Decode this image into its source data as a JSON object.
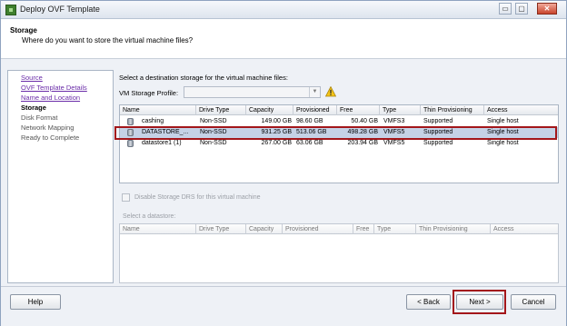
{
  "window": {
    "title": "Deploy OVF Template",
    "min_glyph": "▭",
    "max_glyph": "▢",
    "close_glyph": "✕"
  },
  "header": {
    "title": "Storage",
    "subtitle": "Where do you want to store the virtual machine files?"
  },
  "nav": {
    "items": [
      {
        "label": "Source",
        "state": "link"
      },
      {
        "label": "OVF Template Details",
        "state": "link"
      },
      {
        "label": "Name and Location",
        "state": "link"
      },
      {
        "label": "Storage",
        "state": "current"
      },
      {
        "label": "Disk Format",
        "state": "pending"
      },
      {
        "label": "Network Mapping",
        "state": "pending"
      },
      {
        "label": "Ready to Complete",
        "state": "pending"
      }
    ]
  },
  "main": {
    "instruction": "Select a destination storage for the virtual machine files:",
    "profile_label": "VM Storage Profile:",
    "profile_value": "",
    "warning_icon": "warning-icon"
  },
  "storage_table": {
    "columns": [
      "Name",
      "Drive Type",
      "Capacity",
      "Provisioned",
      "Free",
      "Type",
      "Thin Provisioning",
      "Access"
    ],
    "rows": [
      {
        "name": "cashing",
        "drive_type": "Non-SSD",
        "capacity": "149.00 GB",
        "provisioned": "98.60 GB",
        "free": "50.40 GB",
        "type": "VMFS3",
        "thin": "Supported",
        "access": "Single host"
      },
      {
        "name": "DATASTORE_...",
        "drive_type": "Non-SSD",
        "capacity": "931.25 GB",
        "provisioned": "513.06 GB",
        "free": "498.28 GB",
        "type": "VMFS5",
        "thin": "Supported",
        "access": "Single host"
      },
      {
        "name": "datastore1 (1)",
        "drive_type": "Non-SSD",
        "capacity": "267.00 GB",
        "provisioned": "63.06 GB",
        "free": "203.94 GB",
        "type": "VMFS5",
        "thin": "Supported",
        "access": "Single host"
      }
    ]
  },
  "sdrs": {
    "label": "Disable Storage DRS for this virtual machine"
  },
  "datastore_table": {
    "label": "Select a datastore:",
    "columns": [
      "Name",
      "Drive Type",
      "Capacity",
      "Provisioned",
      "Free",
      "Type",
      "Thin Provisioning",
      "Access"
    ]
  },
  "footer": {
    "help": "Help",
    "back": "< Back",
    "next": "Next >",
    "cancel": "Cancel"
  },
  "colors": {
    "highlight": "#a3161a",
    "selected_row": "#c5d2e6",
    "link": "#6a2ca8"
  }
}
